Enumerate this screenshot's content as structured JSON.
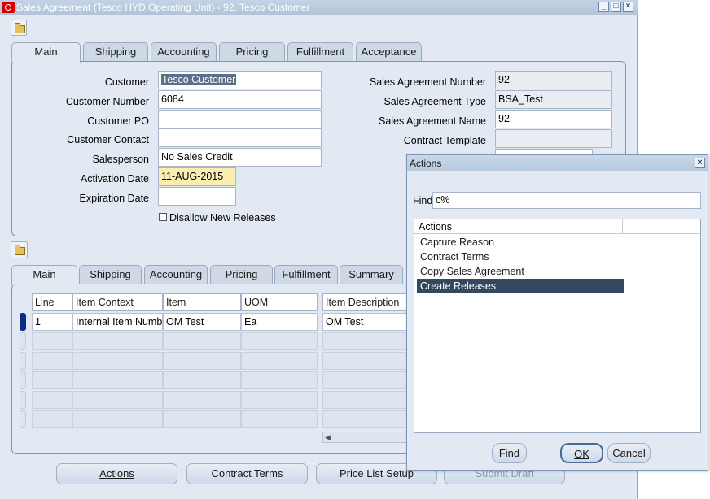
{
  "window": {
    "title": "Sales Agreement (Tesco HYD Operating Unit) - 92, Tesco Customer"
  },
  "header_tabs": [
    "Main",
    "Shipping",
    "Accounting",
    "Pricing",
    "Fulfillment",
    "Acceptance"
  ],
  "header": {
    "customer_label": "Customer",
    "customer_value": "Tesco Customer",
    "customer_number_label": "Customer Number",
    "customer_number_value": "6084",
    "customer_po_label": "Customer PO",
    "customer_po_value": "",
    "customer_contact_label": "Customer Contact",
    "customer_contact_value": "",
    "salesperson_label": "Salesperson",
    "salesperson_value": "No Sales Credit",
    "activation_date_label": "Activation Date",
    "activation_date_value": "11-AUG-2015",
    "expiration_date_label": "Expiration Date",
    "expiration_date_value": "",
    "disallow_label": "Disallow New Releases",
    "sa_number_label": "Sales Agreement Number",
    "sa_number_value": "92",
    "sa_type_label": "Sales Agreement Type",
    "sa_type_value": "BSA_Test",
    "sa_name_label": "Sales Agreement Name",
    "sa_name_value": "92",
    "contract_template_label": "Contract Template",
    "contract_template_value": ""
  },
  "line_tabs": [
    "Main",
    "Shipping",
    "Accounting",
    "Pricing",
    "Fulfillment",
    "Summary"
  ],
  "lines": {
    "columns": [
      "Line",
      "Item Context",
      "Item",
      "UOM",
      "Item Description"
    ],
    "rows": [
      [
        "1",
        "Internal Item Numb",
        "OM Test",
        "Ea",
        "OM Test"
      ]
    ]
  },
  "buttons": {
    "actions": "Actions",
    "contract_terms": "Contract Terms",
    "price_list_setup": "Price List Setup",
    "submit_draft": "Submit Draft"
  },
  "dialog": {
    "title": "Actions",
    "find_label": "Find",
    "find_value": "c%",
    "list_header": "Actions",
    "items": [
      "Capture Reason",
      "Contract Terms",
      "Copy Sales Agreement",
      "Create Releases"
    ],
    "selected_index": 3,
    "find_button": "Find",
    "ok_button": "OK",
    "cancel_button": "Cancel"
  }
}
